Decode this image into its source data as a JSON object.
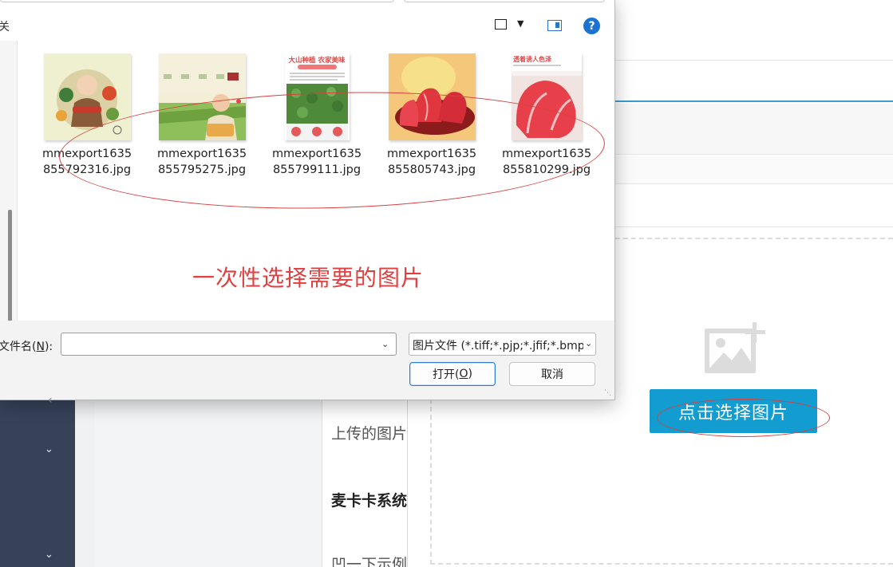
{
  "dialog": {
    "left_label": "关",
    "files": [
      {
        "name_line1": "mmexport1635",
        "name_line2": "855792316.jpg"
      },
      {
        "name_line1": "mmexport1635",
        "name_line2": "855795275.jpg"
      },
      {
        "name_line1": "mmexport1635",
        "name_line2": "855799111.jpg"
      },
      {
        "name_line1": "mmexport1635",
        "name_line2": "855805743.jpg"
      },
      {
        "name_line1": "mmexport1635",
        "name_line2": "855810299.jpg"
      }
    ],
    "thumb3": {
      "title": "大山种植 农家美味"
    },
    "thumb5": {
      "title": "透着诱人色泽"
    },
    "annotation": "一次性选择需要的图片",
    "filename_label_prefix": "文件名(",
    "filename_label_key": "N",
    "filename_label_suffix": "):",
    "filename_value": "",
    "filetype_value": "图片文件 (*.tiff;*.pjp;*.jfif;*.bmp",
    "open_label_prefix": "打开(",
    "open_label_key": "O",
    "open_label_suffix": ")",
    "cancel_label": "取消",
    "help_glyph": "?"
  },
  "background": {
    "uploaded_text": "上传的图片",
    "heading_text": "麦卡卡系统",
    "example_text": "凹一下示例",
    "select_button_label": "点击选择图片"
  },
  "colors": {
    "accent_blue": "#129ccf",
    "annotation_red": "#e04040",
    "sidebar_dark": "#374259"
  }
}
